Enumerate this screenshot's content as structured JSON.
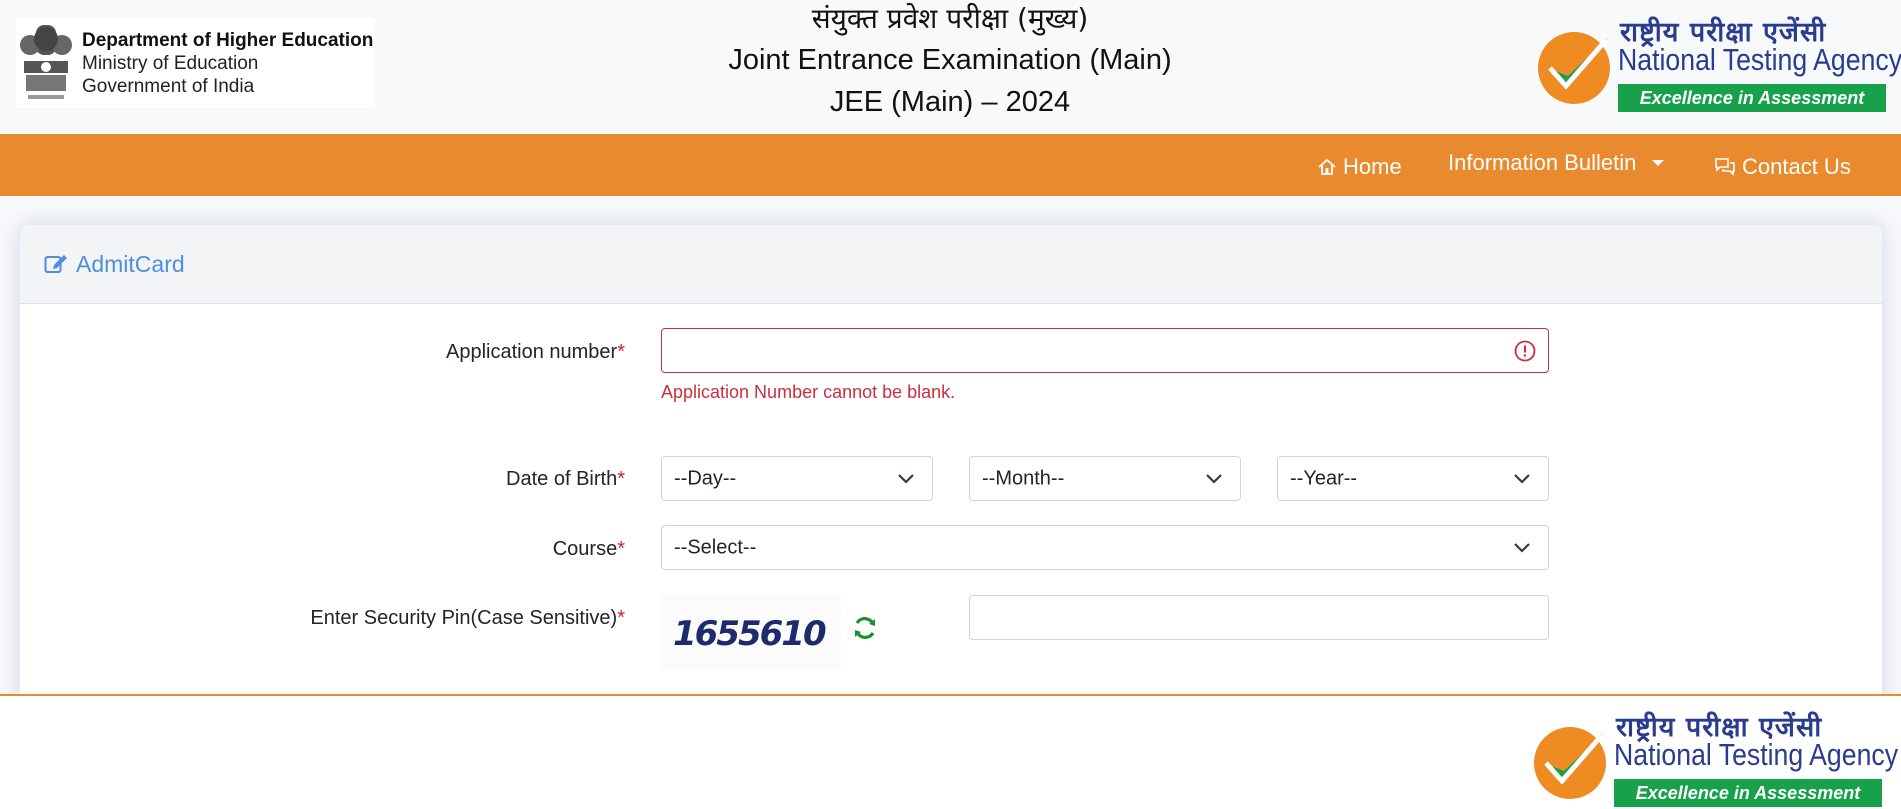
{
  "header": {
    "dept_line1": "Department of Higher Education",
    "dept_line2": "Ministry of Education",
    "dept_line3": "Government of India",
    "title_hindi": "संयुक्त प्रवेश परीक्षा (मुख्य)",
    "title_english": "Joint Entrance Examination (Main)",
    "title_year": "JEE (Main) – 2024",
    "nta_hindi": "राष्ट्रीय परीक्षा एजेंसी",
    "nta_english": "National Testing Agency",
    "nta_tagline": "Excellence in Assessment"
  },
  "nav": {
    "home": "Home",
    "bulletin": "Information Bulletin",
    "contact": "Contact Us"
  },
  "card": {
    "title": "AdmitCard"
  },
  "form": {
    "app_label": "Application number",
    "app_value": "",
    "app_error": "Application Number cannot be blank.",
    "dob_label": "Date of Birth",
    "day_value": "--Day--",
    "month_value": "--Month--",
    "year_value": "--Year--",
    "course_label": "Course",
    "course_value": "--Select--",
    "pin_label": "Enter Security Pin(Case Sensitive)",
    "captcha_text": "1655610",
    "pin_value": "",
    "required_mark": "*"
  },
  "colors": {
    "nav_bg": "#ea8a2e",
    "card_title": "#4d8fd8",
    "error": "#c9303c",
    "refresh": "#1a8f2e",
    "nta_green": "#17a14a",
    "nta_blue": "#2a3c8f"
  }
}
